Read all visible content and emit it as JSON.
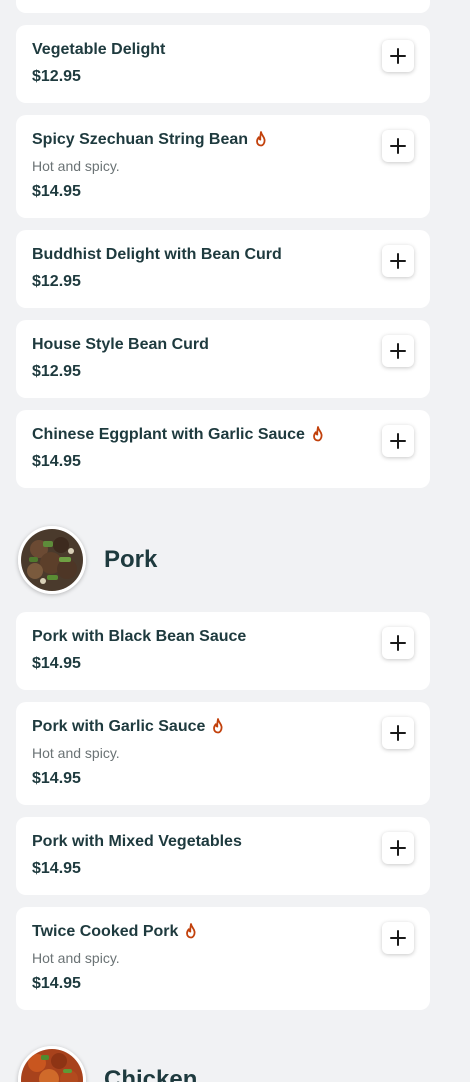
{
  "colors": {
    "background": "#f1f2f4",
    "card": "#ffffff",
    "text_primary": "#1e3a3e",
    "text_secondary": "#6b7375",
    "spicy_icon": "#c2410c"
  },
  "icons": {
    "spicy": "flame-icon",
    "add": "plus-icon"
  },
  "items": [
    {
      "name": "Vegetable Delight",
      "price": "$12.95",
      "spicy": false
    },
    {
      "name": "Spicy Szechuan String Bean",
      "description": "Hot and spicy.",
      "price": "$14.95",
      "spicy": true
    },
    {
      "name": "Buddhist Delight with Bean Curd",
      "price": "$12.95",
      "spicy": false
    },
    {
      "name": "House Style Bean Curd",
      "price": "$12.95",
      "spicy": false
    },
    {
      "name": "Chinese Eggplant with Garlic Sauce",
      "price": "$14.95",
      "spicy": true
    }
  ],
  "sections": [
    {
      "title": "Pork",
      "items": [
        {
          "name": "Pork with Black Bean Sauce",
          "price": "$14.95",
          "spicy": false
        },
        {
          "name": "Pork with Garlic Sauce",
          "description": "Hot and spicy.",
          "price": "$14.95",
          "spicy": true
        },
        {
          "name": "Pork with Mixed Vegetables",
          "price": "$14.95",
          "spicy": false
        },
        {
          "name": "Twice Cooked Pork",
          "description": "Hot and spicy.",
          "price": "$14.95",
          "spicy": true
        }
      ]
    },
    {
      "title": "Chicken"
    }
  ]
}
